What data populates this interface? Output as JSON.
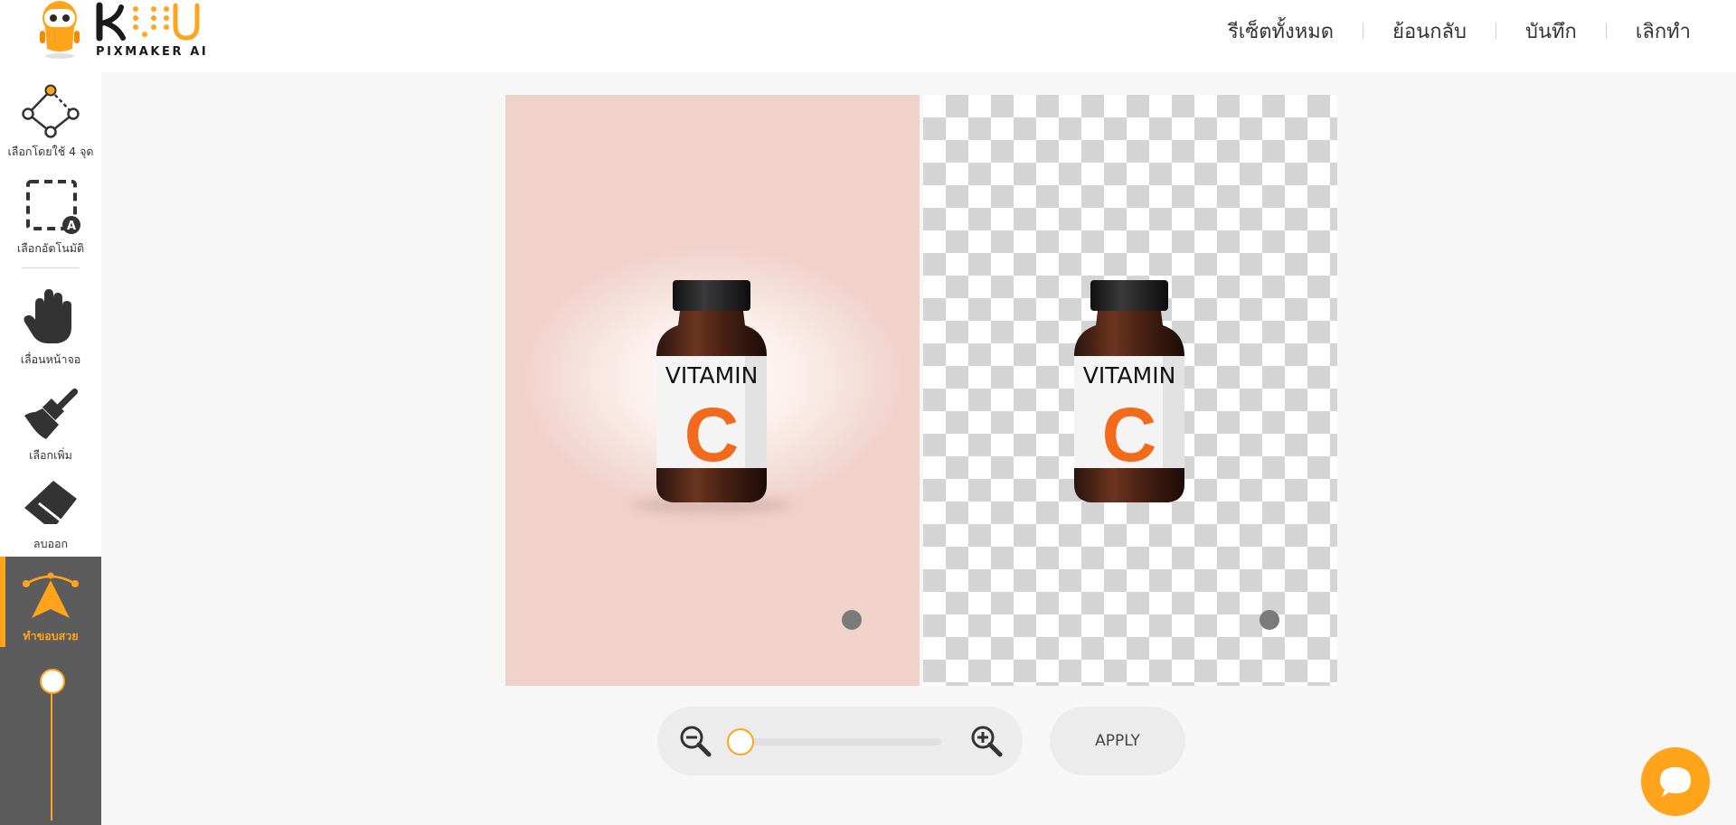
{
  "app": {
    "logo_subtitle": "PIXMAKER AI",
    "brand_color": "#ffa41b"
  },
  "header": {
    "nav": [
      {
        "label": "รีเซ็ตทั้งหมด",
        "icon": null
      },
      {
        "label": "ย้อนกลับ",
        "icon": null
      },
      {
        "label": "บันทึก",
        "icon": null
      },
      {
        "label": "เลิกทำ",
        "icon": null
      }
    ]
  },
  "sidebar": {
    "tools": [
      {
        "label": "เลือกโดยใช้ 4 จุด",
        "icon": "four-point-select-icon"
      },
      {
        "label": "เลือกอัตโนมัติ",
        "icon": "auto-select-icon"
      },
      {
        "label": "เลื่อนหน้าจอ",
        "icon": "hand-pan-icon"
      },
      {
        "label": "เลือกเพิ่ม",
        "icon": "brush-add-icon"
      },
      {
        "label": "ลบออก",
        "icon": "eraser-icon"
      },
      {
        "label": "ทำขอบสวย",
        "icon": "smooth-edge-icon",
        "active": true
      }
    ],
    "brush_size_level": 0
  },
  "canvas": {
    "product_label_top": "VITAMIN",
    "product_label_letter": "C",
    "label_accent_color": "#f26a1b"
  },
  "zoom": {
    "level": 0
  },
  "actions": {
    "apply_label": "APPLY"
  },
  "chat": {
    "icon": "chat-bubble-icon"
  }
}
